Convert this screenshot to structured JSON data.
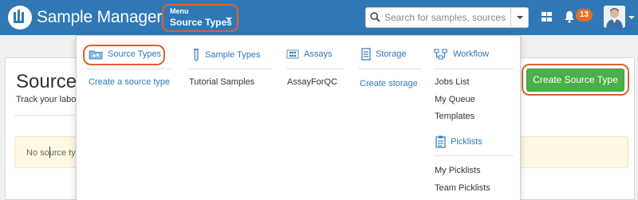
{
  "app": {
    "title": "Sample Manager"
  },
  "menu_button": {
    "small_label": "Menu",
    "main_label": "Source Types"
  },
  "search": {
    "placeholder": "Search for samples, sources, ..."
  },
  "notifications": {
    "count": "13"
  },
  "page": {
    "title": "Source",
    "subtitle": "Track your labo",
    "empty_message": "No source ty",
    "create_button": "Create Source Type"
  },
  "dropdown": {
    "source_types": {
      "label": "Source Types",
      "create_link": "Create a source type"
    },
    "sample_types": {
      "label": "Sample Types",
      "items": [
        "Tutorial Samples"
      ]
    },
    "assays": {
      "label": "Assays",
      "items": [
        "AssayForQC"
      ]
    },
    "storage": {
      "label": "Storage",
      "create_link": "Create storage"
    },
    "workflow": {
      "label": "Workflow",
      "items": [
        "Jobs List",
        "My Queue",
        "Templates"
      ]
    },
    "picklists": {
      "label": "Picklists",
      "items": [
        "My Picklists",
        "Team Picklists"
      ]
    }
  },
  "colors": {
    "navbar": "#2f78b5",
    "accent_link": "#2f78b5",
    "highlight_ring": "#e35f2e",
    "create_button": "#4cae4c",
    "badge": "#e86c28"
  },
  "icons": [
    "logo-icon",
    "search-icon",
    "grid-icon",
    "bell-icon",
    "avatar",
    "source-types-icon",
    "sample-types-icon",
    "assays-icon",
    "storage-icon",
    "workflow-icon",
    "picklists-icon"
  ]
}
